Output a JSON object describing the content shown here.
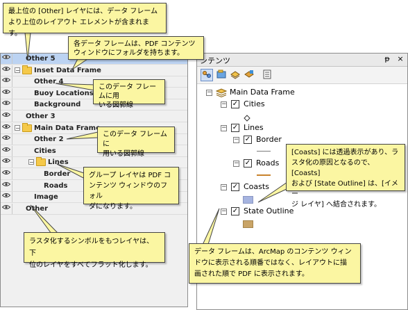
{
  "pdf_layers": {
    "rows": [
      {
        "label": "Other 5",
        "depth": 0,
        "has_expander": false,
        "is_folder": false,
        "selected": true
      },
      {
        "label": "Inset Data Frame",
        "depth": 0,
        "has_expander": true,
        "expander": "−",
        "is_folder": true,
        "selected": false
      },
      {
        "label": "Other 4",
        "depth": 1,
        "has_expander": false,
        "is_folder": false,
        "selected": false
      },
      {
        "label": "Buoy Locations",
        "depth": 1,
        "has_expander": false,
        "is_folder": false,
        "selected": false
      },
      {
        "label": "Background",
        "depth": 1,
        "has_expander": false,
        "is_folder": false,
        "selected": false
      },
      {
        "label": "Other 3",
        "depth": 0,
        "has_expander": false,
        "is_folder": false,
        "selected": false
      },
      {
        "label": "Main Data Frame",
        "depth": 0,
        "has_expander": true,
        "expander": "−",
        "is_folder": true,
        "selected": false
      },
      {
        "label": "Other 2",
        "depth": 1,
        "has_expander": false,
        "is_folder": false,
        "selected": false
      },
      {
        "label": "Cities",
        "depth": 1,
        "has_expander": false,
        "is_folder": false,
        "selected": false
      },
      {
        "label": "Lines",
        "depth": 1,
        "has_expander": true,
        "expander": "−",
        "is_folder": true,
        "selected": false
      },
      {
        "label": "Border",
        "depth": 2,
        "has_expander": false,
        "is_folder": false,
        "selected": false
      },
      {
        "label": "Roads",
        "depth": 2,
        "has_expander": false,
        "is_folder": false,
        "selected": false
      },
      {
        "label": "Image",
        "depth": 1,
        "has_expander": false,
        "is_folder": false,
        "selected": false
      },
      {
        "label": "Other",
        "depth": 0,
        "has_expander": false,
        "is_folder": false,
        "selected": false
      }
    ]
  },
  "toc": {
    "title": "ンテンツ",
    "pin_glyph": "ᵽ",
    "close_glyph": "×",
    "toolbar": [
      "list-by-drawing-order-icon",
      "list-by-source-icon",
      "list-by-visibility-icon",
      "list-by-selection-icon",
      "options-icon"
    ],
    "data_frame": "Main Data Frame",
    "layers": {
      "cities": "Cities",
      "lines": "Lines",
      "border": "Border",
      "roads": "Roads",
      "coasts": "Coasts",
      "state_outline": "State Outline"
    },
    "check_glyph": "✓",
    "collapse_glyph": "−",
    "colors": {
      "coasts_fill": "#a6b4e0",
      "state_outline_fill": "#c9a467",
      "roads_line": "#c8822c",
      "border_line": "#7a7a7a"
    }
  },
  "callouts": {
    "top": "最上位の [Other] レイヤには、データ フレーム\nより上位のレイアウト エレメントが含まれます。",
    "pdf_folder": "各データ フレームは、PDF コンテンツ\nウィンドウにフォルダを持ちます。",
    "inset_frame": "このデータ フレームに用\nいる図郭線",
    "main_frame": "このデータ フレームに\n用いる図郭線",
    "group_layer": "グループ レイヤは PDF コ\nンテンツ ウィンドウのフォル\nダになります。",
    "raster": "ラスタ化するシンボルをもつレイヤは、下\n位のレイヤをすべてフラット化します。",
    "transparency": "[Coasts] には透過表示があり、ラ\nスタ化の原因となるので、[Coasts]\nおよび [State Outline] は、[イメー\nジ レイヤ] へ結合されます。",
    "drawing_order": "データ フレームは、ArcMap のコンテンツ ウィン\nドウに表示される順番ではなく、レイアウトに描\n画された順で PDF に表示されます。"
  }
}
